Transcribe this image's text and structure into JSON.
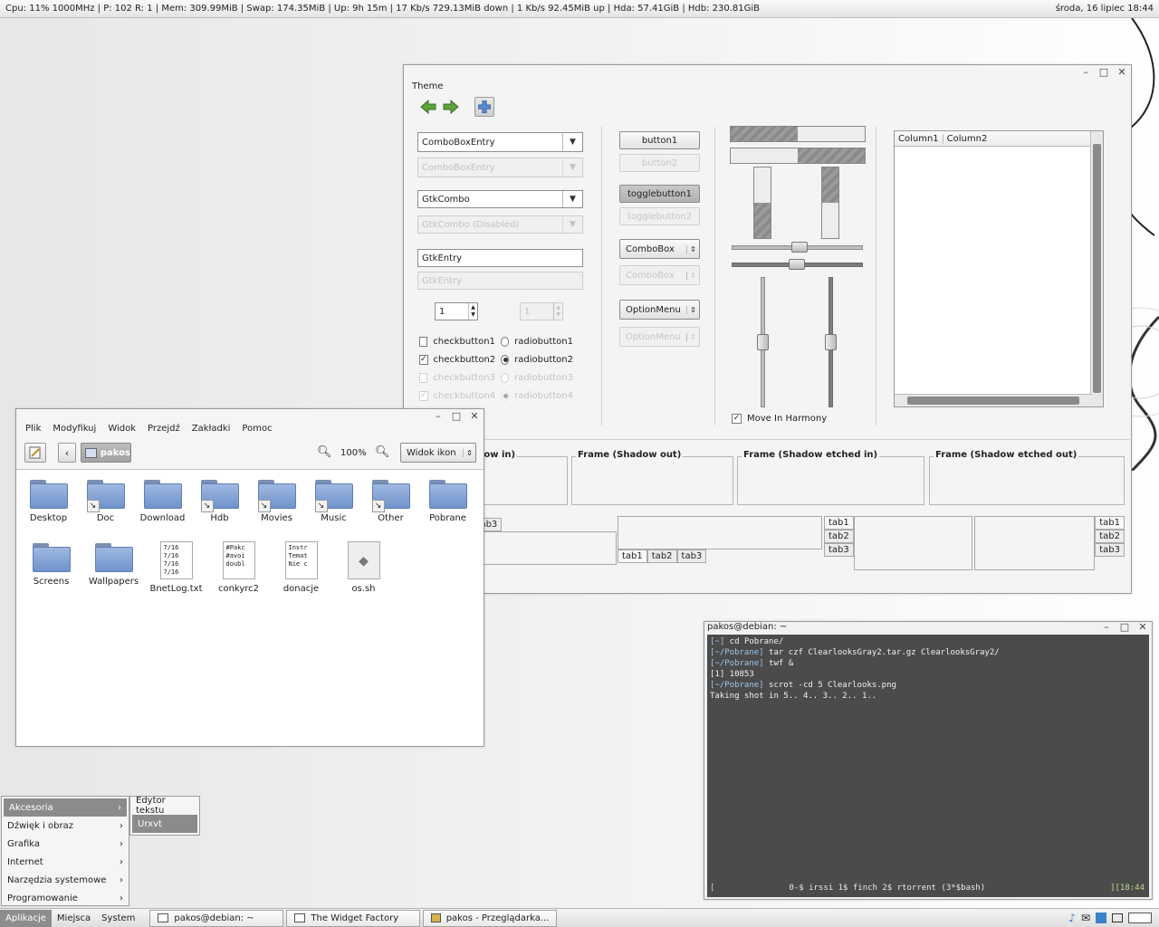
{
  "statusbar": {
    "left": "Cpu: 11% 1000MHz | P: 102 R: 1 | Mem: 309.99MiB | Swap: 174.35MiB | Up: 9h 15m | 17 Kb/s  729.13MiB down | 1 Kb/s  92.45MiB up | Hda: 57.41GiB | Hdb: 230.81GiB",
    "right": "środa, 16 lipiec 18:44"
  },
  "theme_window": {
    "label": "Theme",
    "combos": [
      "ComboBoxEntry",
      "ComboBoxEntry",
      "GtkCombo",
      "GtkCombo (Disabled)"
    ],
    "entries": [
      "GtkEntry",
      "GtkEntry"
    ],
    "spin_values": [
      "1",
      "1"
    ],
    "checks": [
      "checkbutton1",
      "checkbutton2",
      "checkbutton3",
      "checkbutton4"
    ],
    "radios": [
      "radiobutton1",
      "radiobutton2",
      "radiobutton3",
      "radiobutton4"
    ],
    "buttons": [
      "button1",
      "button2",
      "togglebutton1",
      "togglebutton2",
      "ComboBox",
      "ComboBox",
      "OptionMenu",
      "OptionMenu"
    ],
    "move_in_harmony": "Move In Harmony",
    "progress": [
      0.5,
      0.5
    ],
    "treeview_columns": [
      "Column1",
      "Column2"
    ],
    "frames": [
      "Frame (Shadow in)",
      "Frame (Shadow out)",
      "Frame (Shadow etched in)",
      "Frame (Shadow etched out)"
    ],
    "tabs": [
      "tab1",
      "tab2",
      "tab3"
    ]
  },
  "file_manager": {
    "menu": [
      "Plik",
      "Modyfikuj",
      "Widok",
      "Przejdź",
      "Zakładki",
      "Pomoc"
    ],
    "location": "pakos",
    "zoom": "100%",
    "view_mode": "Widok ikon",
    "items_row1": [
      "Desktop",
      "Doc",
      "Download",
      "Hdb",
      "Movies",
      "Music",
      "Other",
      "Pobrane"
    ],
    "items_row2": [
      "Screens",
      "Wallpapers",
      "BnetLog.txt",
      "conkyrc2",
      "donacje",
      "os.sh"
    ],
    "file_previews": {
      "bnetlog": [
        "7/16",
        "7/16",
        "7/16",
        "7/16"
      ],
      "conkyrc2": [
        "#Pakc",
        "",
        "#avoi",
        "doubl"
      ],
      "donacje": [
        "Instr",
        "",
        "Temat",
        "Nie c"
      ]
    }
  },
  "terminal": {
    "title": "pakos@debian: ~",
    "lines": [
      {
        "prompt": "[~]",
        "cmd": " cd Pobrane/"
      },
      {
        "prompt": "[~/Pobrane]",
        "cmd": " tar czf ClearlooksGray2.tar.gz ClearlooksGray2/"
      },
      {
        "prompt": "[~/Pobrane]",
        "cmd": " twf &"
      },
      {
        "prompt": "",
        "cmd": "[1] 10853"
      },
      {
        "prompt": "[~/Pobrane]",
        "cmd": " scrot -cd 5 Clearlooks.png"
      },
      {
        "prompt": "",
        "cmd": "Taking shot in 5.. 4.. 3.. 2.. 1.."
      }
    ],
    "status_left": "[",
    "status_windows": "0-$ irssi  1$ finch  2$ rtorrent  (3*$bash)",
    "status_right": "][18:44"
  },
  "app_menu": {
    "items": [
      "Akcesoria",
      "Dźwięk i obraz",
      "Grafika",
      "Internet",
      "Narzędzia systemowe",
      "Programowanie"
    ],
    "submenu": [
      "Edytor tekstu",
      "Urxvt"
    ]
  },
  "panel": {
    "menus": [
      "Aplikacje",
      "Miejsca",
      "System"
    ],
    "tasks": [
      "pakos@debian: ~",
      "The Widget Factory",
      "pakos - Przeglądarka..."
    ]
  }
}
